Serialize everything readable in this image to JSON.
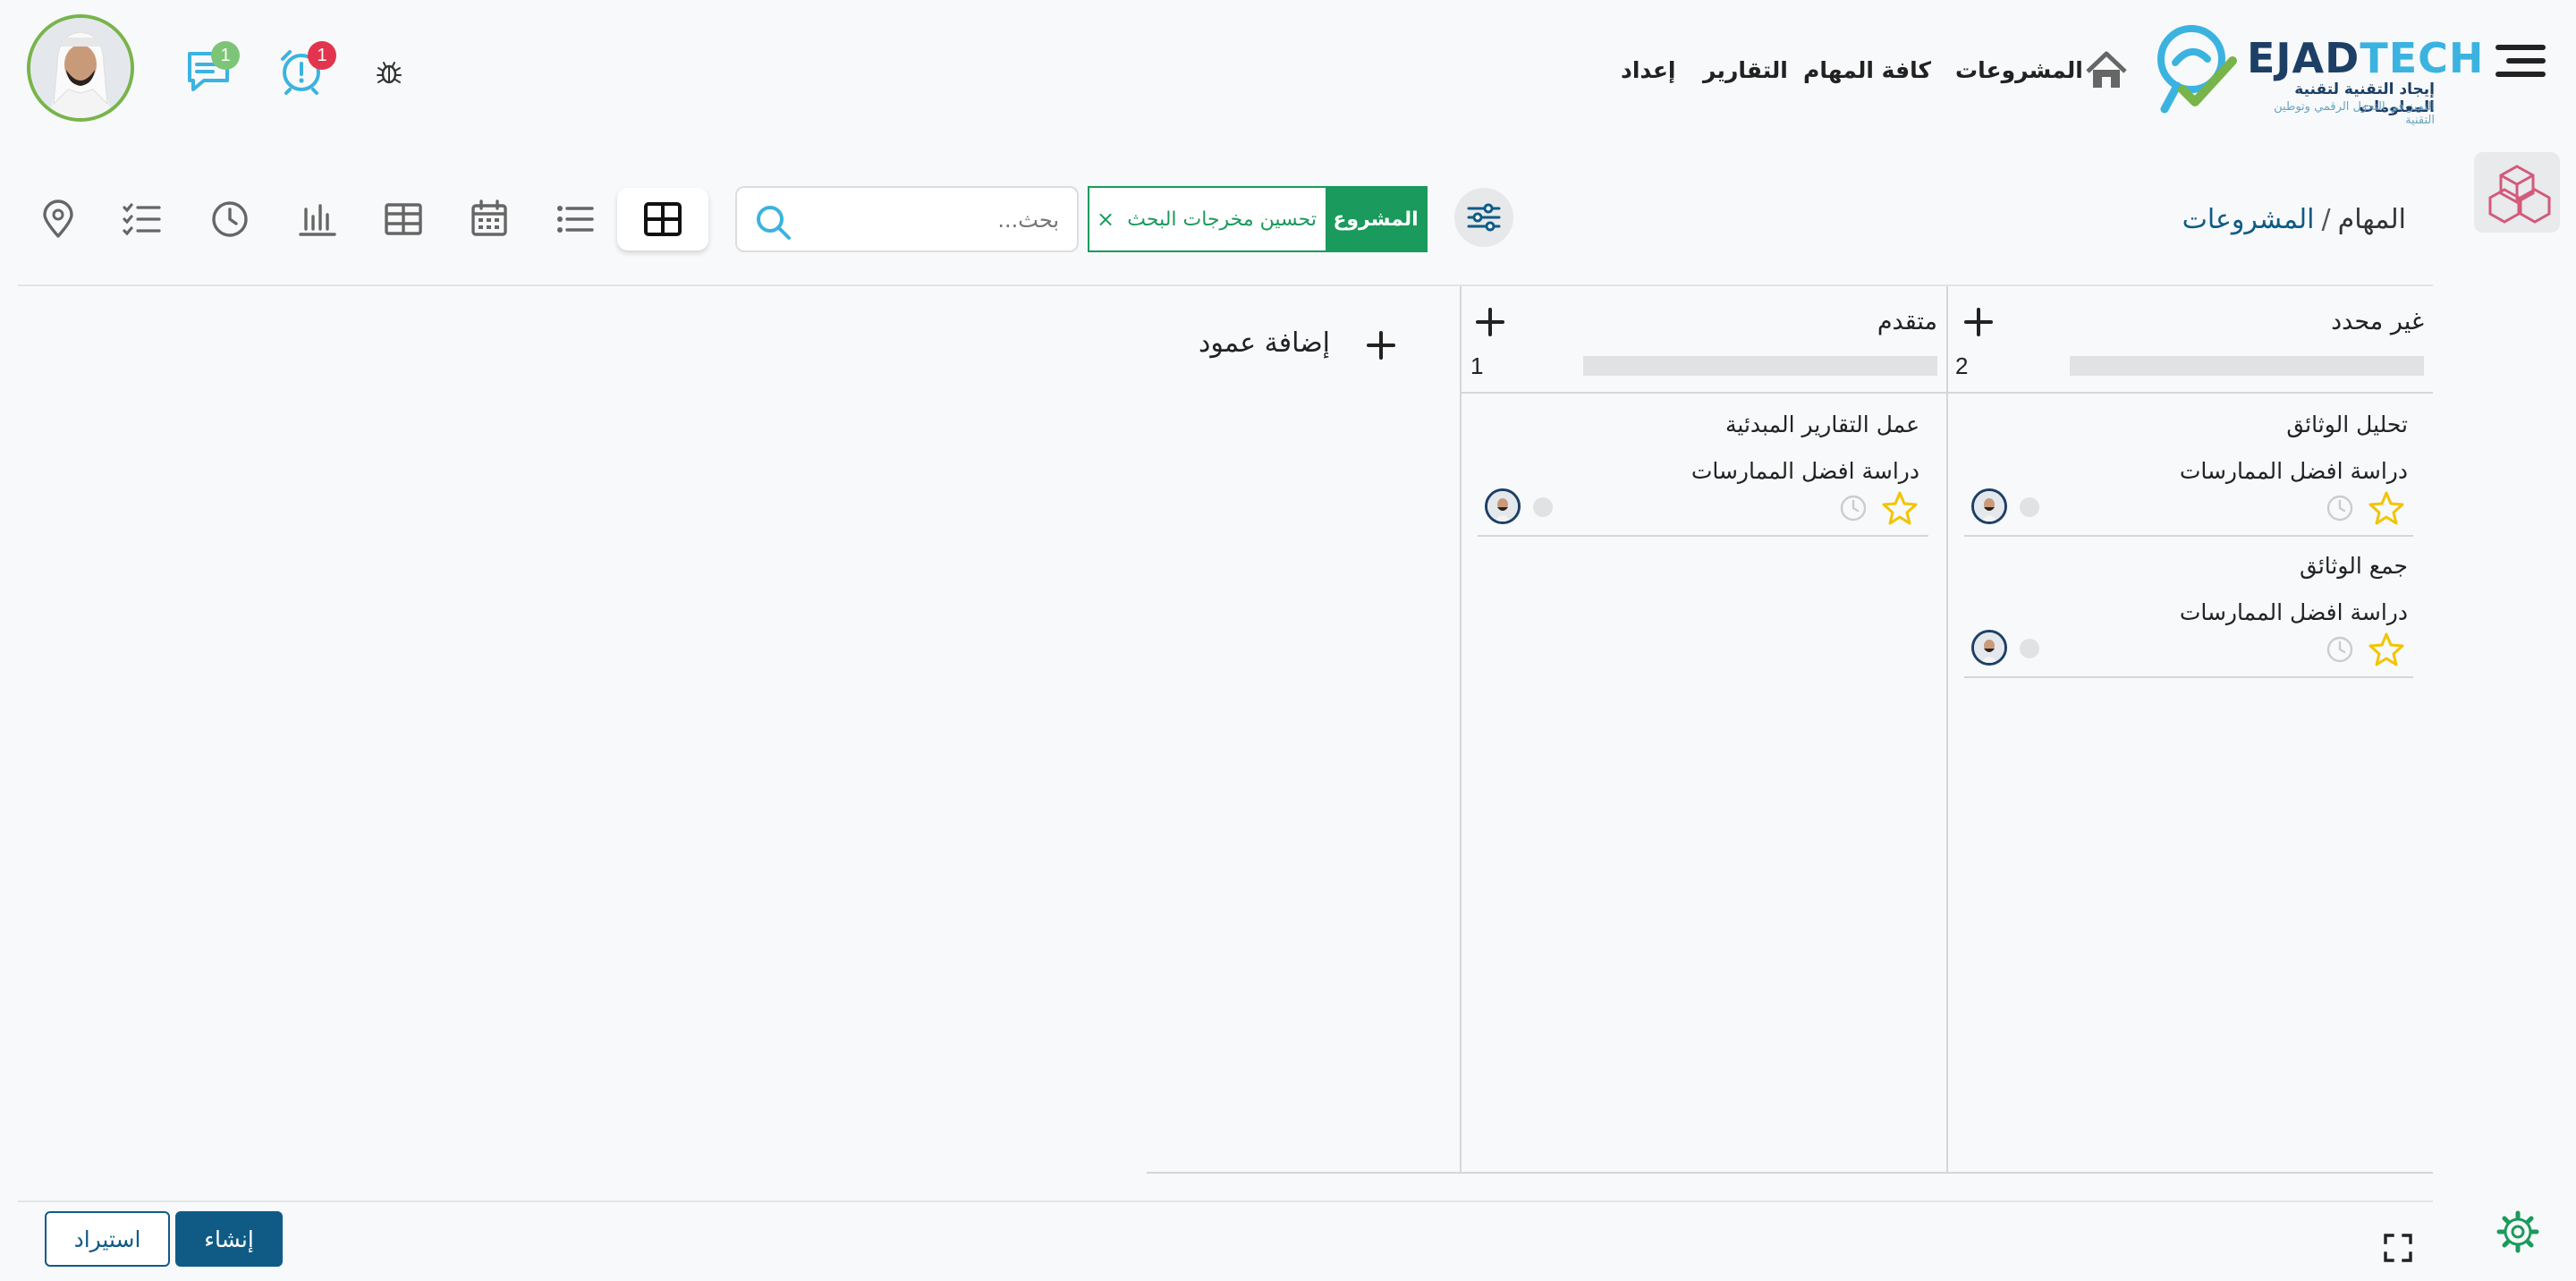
{
  "header": {
    "logo": {
      "word_a": "EJAD",
      "word_b": "TECH",
      "subtitle_ar": "إيجاد التقنية لتقنية المعلومات",
      "tagline_ar": "التميز في التحول الرقمي وتوطين التقنية"
    },
    "nav": [
      {
        "label": "المشروعات"
      },
      {
        "label": "كافة المهام"
      },
      {
        "label": "التقارير"
      },
      {
        "label": "إعداد"
      }
    ],
    "alarm_badge": "1",
    "chat_badge": "1"
  },
  "toolbar": {
    "breadcrumb": {
      "root": "المشروعات",
      "separator": "/",
      "current": "المهام"
    },
    "filter_chip": {
      "label": "المشروع",
      "value": "تحسين مخرجات البحث",
      "remove": "×"
    },
    "search": {
      "placeholder": "بحث..."
    },
    "views": [
      "board-icon",
      "list-icon",
      "calendar-icon",
      "table-icon",
      "chart-icon",
      "clock-icon",
      "checklist-icon",
      "location-icon"
    ],
    "active_view": "board"
  },
  "board": {
    "columns": [
      {
        "title": "غير محدد",
        "count": "2",
        "cards": [
          {
            "title": "تحليل الوثائق",
            "project": "دراسة افضل الممارسات"
          },
          {
            "title": "جمع الوثائق",
            "project": "دراسة افضل الممارسات"
          }
        ]
      },
      {
        "title": "متقدم",
        "count": "1",
        "cards": [
          {
            "title": "عمل التقارير المبدئية",
            "project": "دراسة افضل الممارسات"
          }
        ]
      }
    ],
    "add_column_label": "إضافة عمود"
  },
  "footer": {
    "create_label": "إنشاء",
    "import_label": "استيراد"
  },
  "colors": {
    "primary": "#0f5b86",
    "green": "#1a9a5c",
    "badge_red": "#e3344d",
    "badge_green": "#7cc576",
    "star": "#f2c400"
  }
}
